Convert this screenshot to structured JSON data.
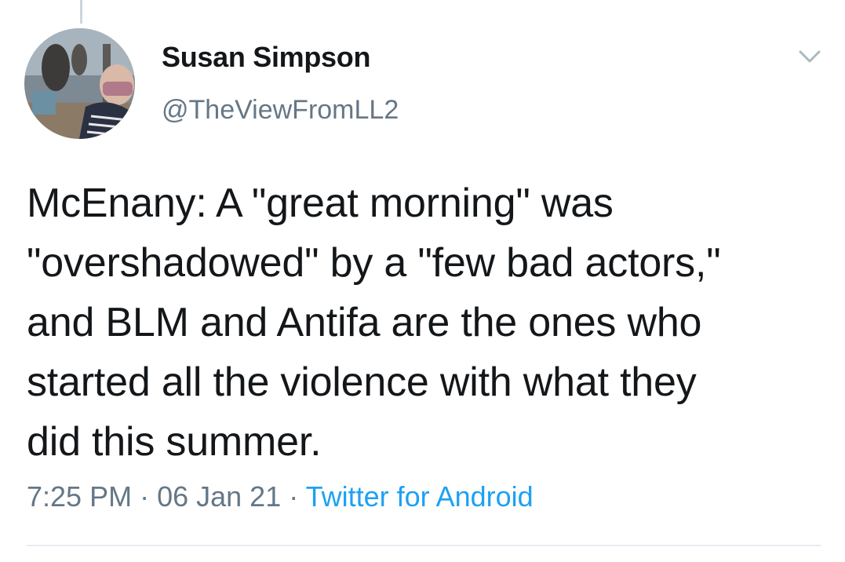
{
  "tweet": {
    "author": {
      "display_name": "Susan Simpson",
      "handle": "@TheViewFromLL2",
      "avatar_icon": "profile-photo"
    },
    "menu_icon": "chevron-down-icon",
    "text": "McEnany: A \"great morning\" was\n\"overshadowed\" by a \"few bad actors,\"\nand BLM and Antifa are the ones who\nstarted all the violence with what they\ndid this summer.",
    "time": "7:25 PM",
    "separator": " · ",
    "date": "06 Jan 21",
    "source": "Twitter for Android"
  },
  "colors": {
    "text": "#14171a",
    "secondary": "#657786",
    "link": "#1da1f2",
    "divider": "#e6ecf0"
  }
}
